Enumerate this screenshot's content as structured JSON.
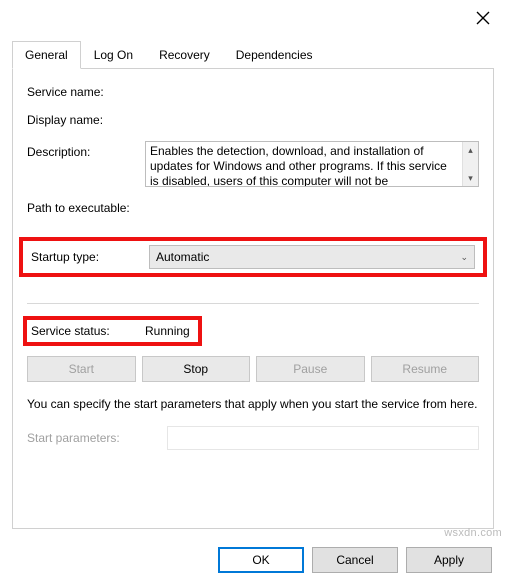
{
  "titlebar": {
    "close_icon": "close"
  },
  "tabs": {
    "general": "General",
    "logon": "Log On",
    "recovery": "Recovery",
    "dependencies": "Dependencies"
  },
  "general": {
    "service_name_label": "Service name:",
    "service_name_value": "",
    "display_name_label": "Display name:",
    "display_name_value": "",
    "description_label": "Description:",
    "description_value": "Enables the detection, download, and installation of updates for Windows and other programs. If this service is disabled, users of this computer will not be",
    "path_label": "Path to executable:",
    "path_value": "",
    "startup_type_label": "Startup type:",
    "startup_type_value": "Automatic",
    "service_status_label": "Service status:",
    "service_status_value": "Running",
    "start_btn": "Start",
    "stop_btn": "Stop",
    "pause_btn": "Pause",
    "resume_btn": "Resume",
    "help_text": "You can specify the start parameters that apply when you start the service from here.",
    "start_params_label": "Start parameters:",
    "start_params_value": ""
  },
  "dialog": {
    "ok": "OK",
    "cancel": "Cancel",
    "apply": "Apply"
  },
  "watermark": "wsxdn.com"
}
